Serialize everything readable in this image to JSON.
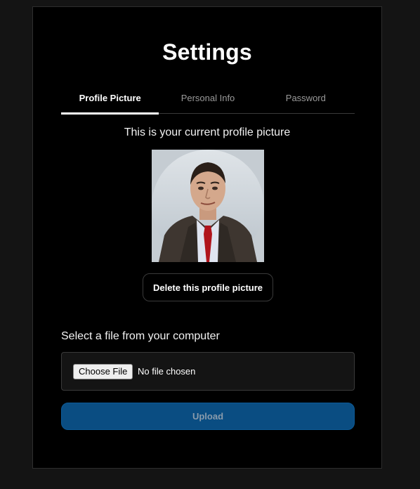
{
  "page": {
    "title": "Settings"
  },
  "tabs": [
    {
      "label": "Profile Picture",
      "active": true
    },
    {
      "label": "Personal Info",
      "active": false
    },
    {
      "label": "Password",
      "active": false
    }
  ],
  "profile": {
    "current_label": "This is your current profile picture",
    "delete_label": "Delete this profile picture"
  },
  "upload": {
    "select_label": "Select a file from your computer",
    "choose_label": "Choose File",
    "file_status": "No file chosen",
    "upload_label": "Upload"
  },
  "colors": {
    "background": "#141414",
    "card": "#000000",
    "accent": "#0a4d82",
    "tab_inactive": "#9a9a9a"
  }
}
